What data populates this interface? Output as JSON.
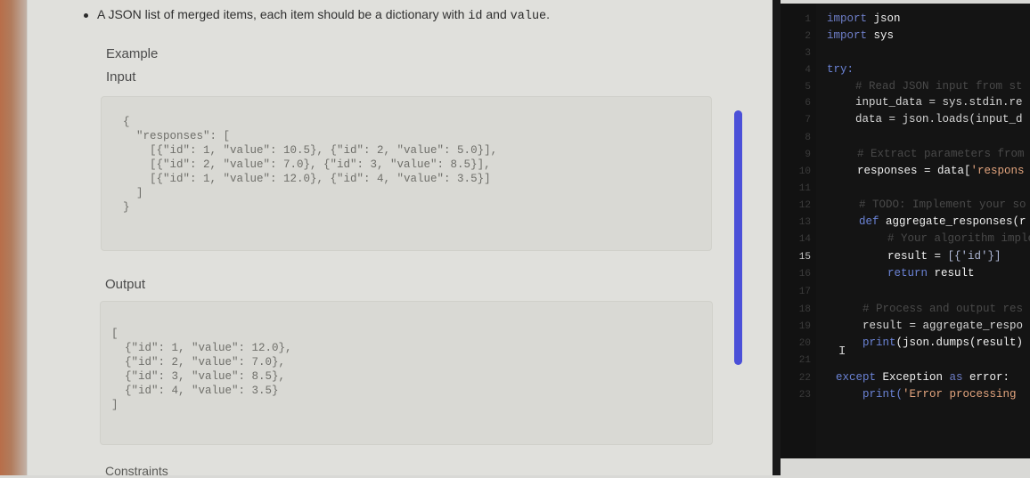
{
  "description": {
    "bullet_text": "A JSON list of merged items, each item should be a dictionary with ",
    "code_id": "id",
    "and_text": " and ",
    "code_value": "value",
    "end_text": "."
  },
  "example": {
    "label": "Example",
    "input_label": "Input",
    "output_label": "Output",
    "input_lines": [
      "{",
      "  \"responses\": [",
      "    [{\"id\": 1, \"value\": 10.5}, {\"id\": 2, \"value\": 5.0}],",
      "    [{\"id\": 2, \"value\": 7.0}, {\"id\": 3, \"value\": 8.5}],",
      "    [{\"id\": 1, \"value\": 12.0}, {\"id\": 4, \"value\": 3.5}]",
      "  ]",
      "}"
    ],
    "output_lines": [
      "[",
      "  {\"id\": 1, \"value\": 12.0},",
      "  {\"id\": 2, \"value\": 7.0},",
      "  {\"id\": 3, \"value\": 8.5},",
      "  {\"id\": 4, \"value\": 3.5}",
      "]"
    ]
  },
  "constraints_label": "Constraints",
  "editor": {
    "line_numbers": [
      "1",
      "2",
      "3",
      "4",
      "5",
      "6",
      "7",
      "8",
      "9",
      "10",
      "11",
      "12",
      "13",
      "14",
      "15",
      "16",
      "17",
      "18",
      "19",
      "20",
      "21",
      "22",
      "23"
    ],
    "active_line": "15",
    "lines": [
      {
        "text": "import json"
      },
      {
        "text": "import sys"
      },
      {
        "text": ""
      },
      {
        "text": "try:"
      },
      {
        "text": "    # Read JSON input from st"
      },
      {
        "text": "    input_data = sys.stdin.re"
      },
      {
        "text": "    data = json.loads(input_d"
      },
      {
        "text": ""
      },
      {
        "text": "    # Extract parameters from"
      },
      {
        "text": "    responses = data['respons"
      },
      {
        "text": ""
      },
      {
        "text": "    # TODO: Implement your so"
      },
      {
        "text": "    def aggregate_responses(r"
      },
      {
        "text": "        # Your algorithm imple"
      },
      {
        "text": "        result = [{'id'}]"
      },
      {
        "text": "        return result"
      },
      {
        "text": ""
      },
      {
        "text": "    # Process and output res"
      },
      {
        "text": "    result = aggregate_respo"
      },
      {
        "text": "    print(json.dumps(result)"
      },
      {
        "text": ""
      },
      {
        "text": "except Exception as error:"
      },
      {
        "text": "    print('Error processing"
      }
    ],
    "cursor_glyph": "I"
  },
  "colors": {
    "scroll_thumb": "#4b50d8",
    "editor_bg": "#141414",
    "keyword": "#6e7ec8",
    "string": "#e4a57e"
  }
}
